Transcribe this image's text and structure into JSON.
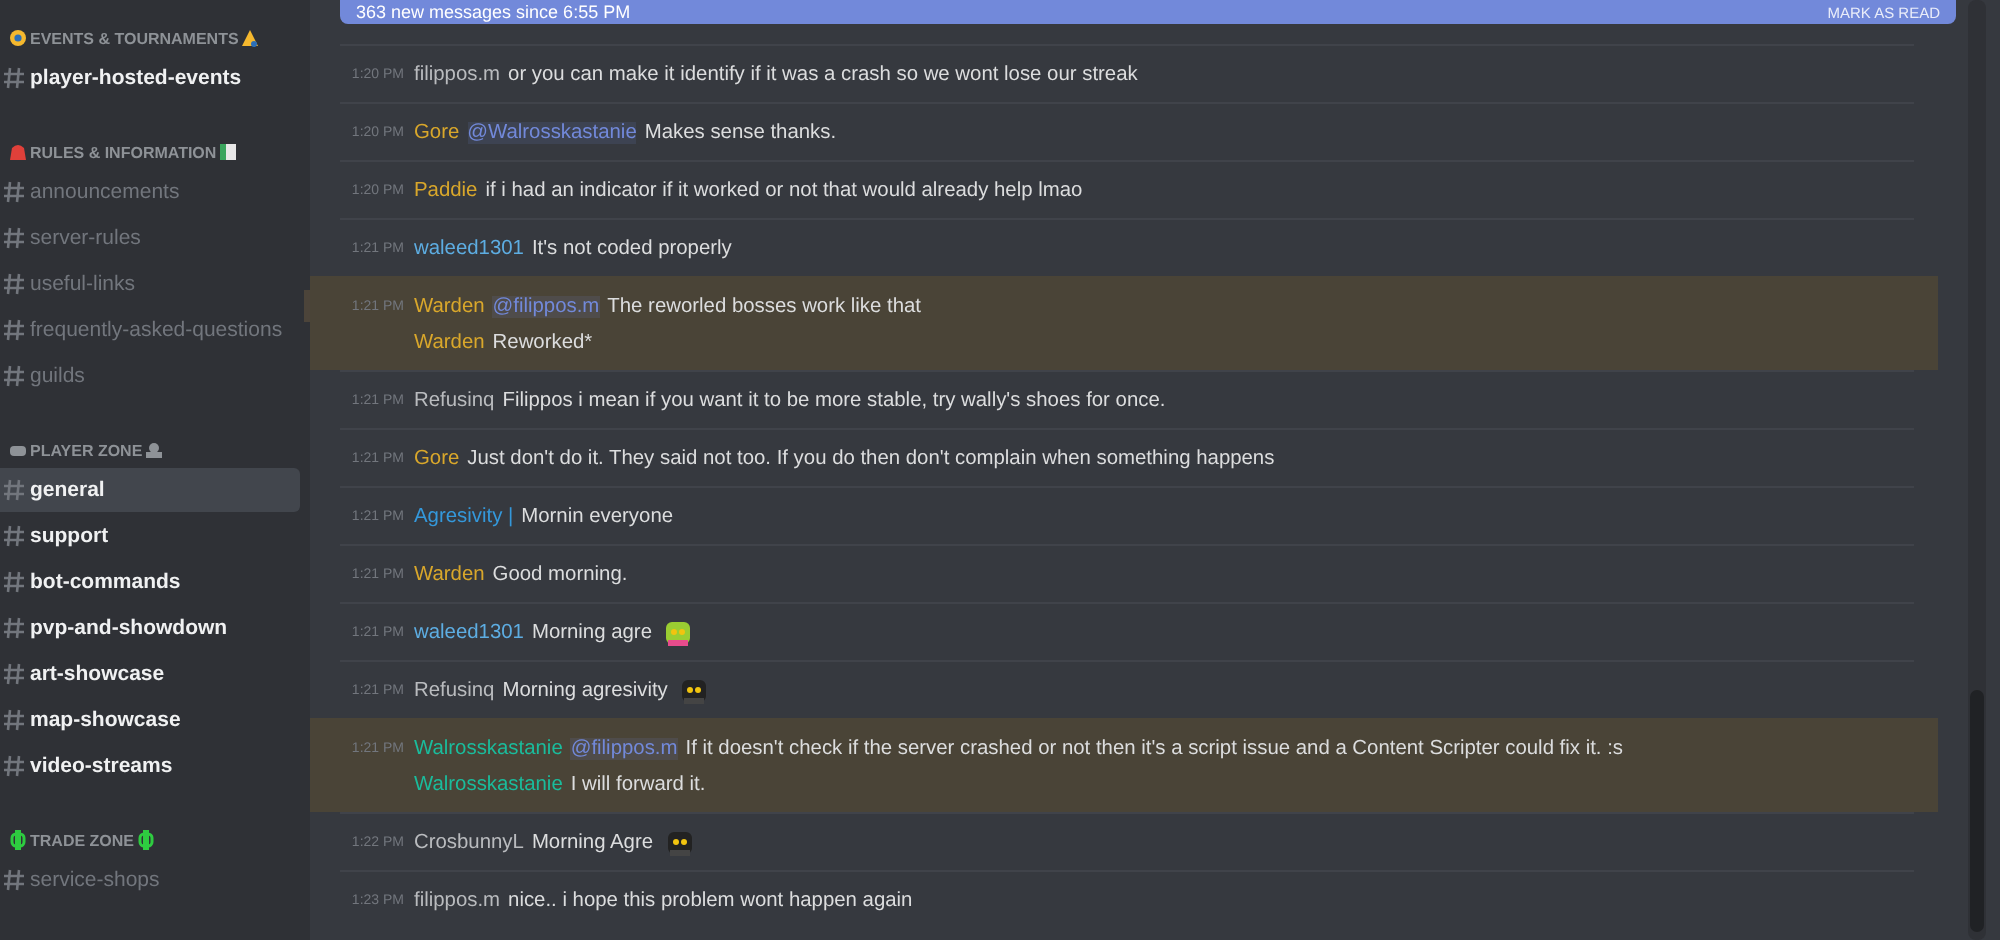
{
  "sidebar": {
    "categories": [
      {
        "name": "EVENTS & TOURNAMENTS",
        "channels": [
          {
            "name": "player-hosted-events",
            "unread": true,
            "selected": false
          }
        ]
      },
      {
        "name": "RULES & INFORMATION",
        "channels": [
          {
            "name": "announcements",
            "unread": false,
            "selected": false
          },
          {
            "name": "server-rules",
            "unread": false,
            "selected": false
          },
          {
            "name": "useful-links",
            "unread": false,
            "selected": false
          },
          {
            "name": "frequently-asked-questions",
            "unread": false,
            "selected": false
          },
          {
            "name": "guilds",
            "unread": false,
            "selected": false
          }
        ]
      },
      {
        "name": "PLAYER ZONE",
        "channels": [
          {
            "name": "general",
            "unread": true,
            "selected": true
          },
          {
            "name": "support",
            "unread": true,
            "selected": false
          },
          {
            "name": "bot-commands",
            "unread": true,
            "selected": false
          },
          {
            "name": "pvp-and-showdown",
            "unread": true,
            "selected": false
          },
          {
            "name": "art-showcase",
            "unread": true,
            "selected": false
          },
          {
            "name": "map-showcase",
            "unread": true,
            "selected": false
          },
          {
            "name": "video-streams",
            "unread": true,
            "selected": false
          }
        ]
      },
      {
        "name": "TRADE ZONE",
        "channels": [
          {
            "name": "service-shops",
            "unread": false,
            "selected": false
          }
        ]
      }
    ]
  },
  "new_messages_bar": {
    "text": "363 new messages since 6:55 PM",
    "action": "MARK AS READ"
  },
  "messages": [
    {
      "time": "1:20 PM",
      "highlighted": false,
      "lines": [
        {
          "author": "filippos.m",
          "color": "#b9bbbe",
          "text": "or you can make it identify if it was a crash so we wont lose our streak",
          "emoji": false
        }
      ]
    },
    {
      "time": "1:20 PM",
      "highlighted": false,
      "lines": [
        {
          "author": "Gore",
          "color": "#d9a72b",
          "mention": "@Walrosskastanie",
          "text": "Makes sense thanks.",
          "emoji": false
        }
      ]
    },
    {
      "time": "1:20 PM",
      "highlighted": false,
      "lines": [
        {
          "author": "Paddie",
          "color": "#d9a72b",
          "text": "if i had an indicator if it worked or not that would already help lmao",
          "emoji": false
        }
      ]
    },
    {
      "time": "1:21 PM",
      "highlighted": false,
      "lines": [
        {
          "author": "waleed1301",
          "color": "#5dade2",
          "text": "It's not coded properly",
          "emoji": false
        }
      ]
    },
    {
      "time": "1:21 PM",
      "highlighted": true,
      "lines": [
        {
          "author": "Warden",
          "color": "#d9a72b",
          "mention": "@filippos.m",
          "text": "The reworled bosses work like that",
          "emoji": false
        },
        {
          "author": "Warden",
          "color": "#d9a72b",
          "text": "Reworked*",
          "emoji": false
        }
      ]
    },
    {
      "time": "1:21 PM",
      "highlighted": false,
      "lines": [
        {
          "author": "Refusinq",
          "color": "#b9bbbe",
          "text": "Filippos i mean if you want it to be more stable, try wally's shoes for once.",
          "emoji": false
        }
      ]
    },
    {
      "time": "1:21 PM",
      "highlighted": false,
      "lines": [
        {
          "author": "Gore",
          "color": "#d9a72b",
          "text": "Just don't do it. They said not too. If you do then don't complain when something happens",
          "emoji": false
        }
      ]
    },
    {
      "time": "1:21 PM",
      "highlighted": false,
      "lines": [
        {
          "author": "Agresivity |",
          "color": "#3498db",
          "text": "Mornin everyone",
          "emoji": false
        }
      ]
    },
    {
      "time": "1:21 PM",
      "highlighted": false,
      "lines": [
        {
          "author": "Warden",
          "color": "#d9a72b",
          "text": "Good morning.",
          "emoji": false
        }
      ]
    },
    {
      "time": "1:21 PM",
      "highlighted": false,
      "lines": [
        {
          "author": "waleed1301",
          "color": "#5dade2",
          "text": "Morning agre",
          "emoji": true
        }
      ]
    },
    {
      "time": "1:21 PM",
      "highlighted": false,
      "lines": [
        {
          "author": "Refusinq",
          "color": "#b9bbbe",
          "text": "Morning agresivity",
          "emoji": true
        }
      ]
    },
    {
      "time": "1:21 PM",
      "highlighted": true,
      "lines": [
        {
          "author": "Walrosskastanie",
          "color": "#1abc9c",
          "mention": "@filippos.m",
          "text": "If it doesn't check if the server crashed or not then it's a script issue and a Content Scripter could fix it. :s",
          "emoji": false
        },
        {
          "author": "Walrosskastanie",
          "color": "#1abc9c",
          "text": "I will forward it.",
          "emoji": false
        }
      ]
    },
    {
      "time": "1:22 PM",
      "highlighted": false,
      "lines": [
        {
          "author": "CrosbunnyL",
          "color": "#b9bbbe",
          "text": "Morning Agre",
          "emoji": true
        }
      ]
    },
    {
      "time": "1:23 PM",
      "highlighted": false,
      "lines": [
        {
          "author": "filippos.m",
          "color": "#b9bbbe",
          "text": "nice.. i hope this problem wont happen again",
          "emoji": false
        }
      ]
    }
  ]
}
